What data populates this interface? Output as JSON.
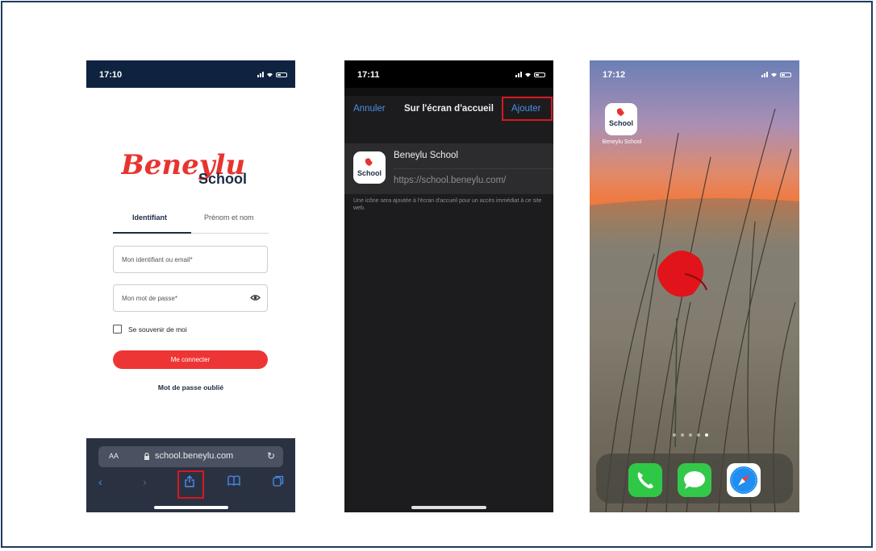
{
  "phone1": {
    "time": "17:10",
    "logo": {
      "brand": "Beneylu",
      "sub": "School"
    },
    "tabs": [
      "Identifiant",
      "Prénom et nom"
    ],
    "fields": {
      "identifier_placeholder": "Mon identifiant ou email*",
      "password_placeholder": "Mon mot de passe*"
    },
    "remember_label": "Se souvenir de moi",
    "connect_label": "Me connecter",
    "forgot_label": "Mot de passe oublié",
    "safari": {
      "aa": "AA",
      "url": "school.beneylu.com"
    }
  },
  "phone2": {
    "time": "17:11",
    "cancel_label": "Annuler",
    "title": "Sur l'écran d'accueil",
    "add_label": "Ajouter",
    "app_name": "Beneylu School",
    "app_url": "https://school.beneylu.com/",
    "caption": "Une icône sera ajoutée à l'écran d'accueil pour un accès immédiat à ce site web.",
    "icon_text": "School"
  },
  "phone3": {
    "time": "17:12",
    "icon_text": "School",
    "icon_label": "Beneylu School",
    "dock_icons": [
      "phone-icon",
      "messages-icon",
      "safari-icon"
    ]
  },
  "colors": {
    "accent_red": "#ee3535",
    "ios_blue": "#4a90e2",
    "navy": "#0f2340",
    "highlight": "#d7181e"
  }
}
